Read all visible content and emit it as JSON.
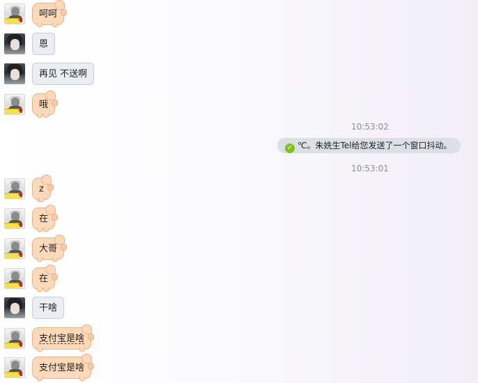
{
  "messages": [
    {
      "text": "呵呵",
      "avatar": "user-a",
      "style": "pig"
    },
    {
      "text": "恩",
      "avatar": "user-b",
      "style": "gray"
    },
    {
      "text": "再见 不送啊",
      "avatar": "user-b",
      "style": "gray"
    },
    {
      "text": "哦",
      "avatar": "user-a",
      "style": "pig"
    },
    {
      "text": "z",
      "avatar": "user-a",
      "style": "pig"
    },
    {
      "text": "在",
      "avatar": "user-a",
      "style": "pig"
    },
    {
      "text": "大哥",
      "avatar": "user-a",
      "style": "pig"
    },
    {
      "text": "在",
      "avatar": "user-a",
      "style": "pig"
    },
    {
      "text": "干啥",
      "avatar": "user-b",
      "style": "gray"
    },
    {
      "text": "支付宝是啥",
      "avatar": "user-a",
      "style": "pig",
      "underlined": true
    },
    {
      "text": "支付宝是啥",
      "avatar": "user-a",
      "style": "pig"
    }
  ],
  "system": {
    "time_1": "10:53:02",
    "notice": "℃。朱姺生Tel给您发送了一个窗口抖动。",
    "time_2": "10:53:01"
  },
  "icons": {
    "notice_icon": "check-circle-icon",
    "avatar_a": "user-avatar-icon",
    "avatar_b": "user-avatar-icon"
  },
  "colors": {
    "pig_bubble": "#fcd9b8",
    "pig_border": "#e9b38a",
    "gray_bubble": "#eaedf1",
    "notice_bg": "#dcdfe4",
    "check": "#7fc31a"
  }
}
